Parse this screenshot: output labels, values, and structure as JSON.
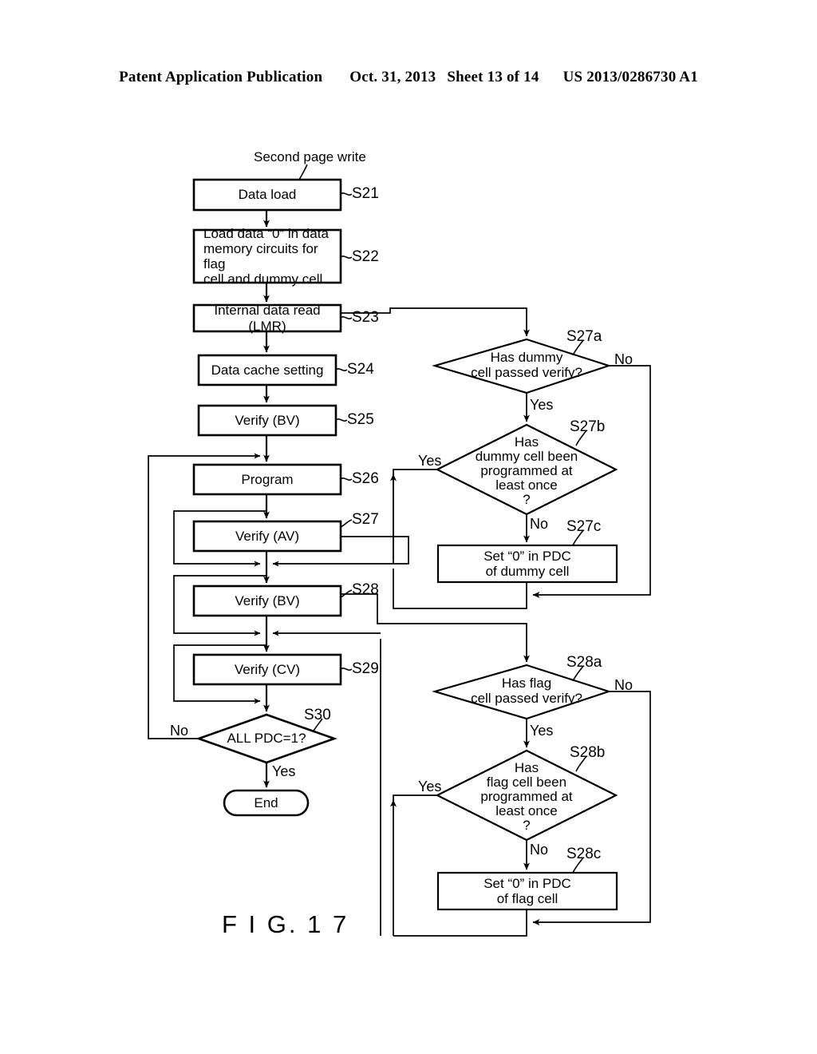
{
  "header": {
    "publication": "Patent Application Publication",
    "date": "Oct. 31, 2013",
    "sheet": "Sheet 13 of 14",
    "patent_number": "US 2013/0286730 A1"
  },
  "figure": {
    "caption": "F I G. 1 7",
    "entry_title": "Second page write"
  },
  "nodes": {
    "s21": {
      "text": "Data load",
      "step": "S21"
    },
    "s22": {
      "text": "Load data “0” in data\nmemory circuits for flag\ncell and dummy cell",
      "step": "S22"
    },
    "s23": {
      "text": "Internal data read (LMR)",
      "step": "S23"
    },
    "s24": {
      "text": "Data cache setting",
      "step": "S24"
    },
    "s25": {
      "text": "Verify (BV)",
      "step": "S25"
    },
    "s26": {
      "text": "Program",
      "step": "S26"
    },
    "s27": {
      "text": "Verify (AV)",
      "step": "S27"
    },
    "s28": {
      "text": "Verify (BV)",
      "step": "S28"
    },
    "s29": {
      "text": "Verify (CV)",
      "step": "S29"
    },
    "s30": {
      "text": "ALL PDC=1?",
      "step": "S30"
    },
    "end": {
      "text": "End"
    },
    "s27a": {
      "text": "Has dummy\ncell passed verify?",
      "step": "S27a"
    },
    "s27b": {
      "text": "Has\ndummy cell been\nprogrammed at\nleast once\n?",
      "step": "S27b"
    },
    "s27c": {
      "text": "Set “0” in PDC\nof dummy cell",
      "step": "S27c"
    },
    "s28a": {
      "text": "Has flag\ncell passed verify?",
      "step": "S28a"
    },
    "s28b": {
      "text": "Has\nflag cell been\nprogrammed at\nleast once\n?",
      "step": "S28b"
    },
    "s28c": {
      "text": "Set “0” in PDC\nof flag cell",
      "step": "S28c"
    }
  },
  "edge_labels": {
    "s30_no": "No",
    "s30_yes": "Yes",
    "s27a_no": "No",
    "s27a_yes": "Yes",
    "s27b_yes": "Yes",
    "s27b_no": "No",
    "s28a_no": "No",
    "s28a_yes": "Yes",
    "s28b_yes": "Yes",
    "s28b_no": "No"
  },
  "colors": {
    "ink": "#000000",
    "paper": "#ffffff"
  }
}
